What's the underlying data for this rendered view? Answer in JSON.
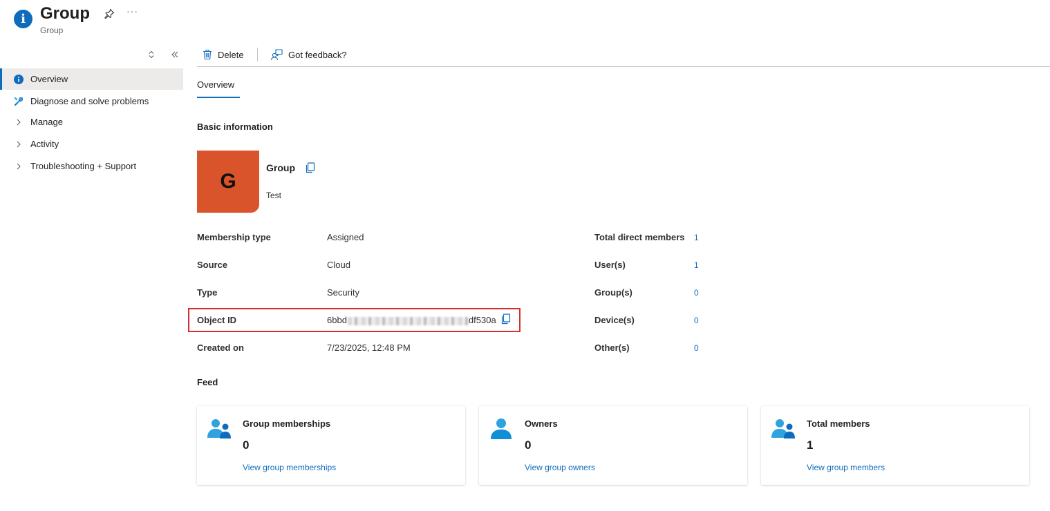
{
  "header": {
    "title": "Group",
    "subtitle": "Group",
    "more_label": "···"
  },
  "sidebar": {
    "items": [
      {
        "label": "Overview",
        "icon": "info-icon",
        "active": true
      },
      {
        "label": "Diagnose and solve problems",
        "icon": "wrench-icon"
      },
      {
        "label": "Manage",
        "icon": "chevron-right-icon"
      },
      {
        "label": "Activity",
        "icon": "chevron-right-icon"
      },
      {
        "label": "Troubleshooting + Support",
        "icon": "chevron-right-icon"
      }
    ]
  },
  "commandbar": {
    "delete_label": "Delete",
    "feedback_label": "Got feedback?"
  },
  "tabs": {
    "overview": "Overview"
  },
  "basic_info": {
    "heading": "Basic information",
    "avatar_letter": "G",
    "group_name": "Group",
    "description": "Test",
    "properties": [
      {
        "label": "Membership type",
        "value": "Assigned"
      },
      {
        "label": "Source",
        "value": "Cloud"
      },
      {
        "label": "Type",
        "value": "Security"
      },
      {
        "label": "Object ID",
        "value_prefix": "6bbd",
        "value_suffix": "df530a"
      },
      {
        "label": "Created on",
        "value": "7/23/2025, 12:48 PM"
      }
    ],
    "stats": [
      {
        "label": "Total direct members",
        "value": "1"
      },
      {
        "label": "User(s)",
        "value": "1"
      },
      {
        "label": "Group(s)",
        "value": "0"
      },
      {
        "label": "Device(s)",
        "value": "0"
      },
      {
        "label": "Other(s)",
        "value": "0"
      }
    ]
  },
  "feed": {
    "heading": "Feed",
    "cards": [
      {
        "title": "Group memberships",
        "count": "0",
        "link": "View group memberships",
        "icon": "users-icon"
      },
      {
        "title": "Owners",
        "count": "0",
        "link": "View group owners",
        "icon": "user-icon"
      },
      {
        "title": "Total members",
        "count": "1",
        "link": "View group members",
        "icon": "users-icon"
      }
    ]
  },
  "colors": {
    "accent": "#0f6cbd",
    "avatar": "#d9542b",
    "highlight": "#d32f2f"
  }
}
